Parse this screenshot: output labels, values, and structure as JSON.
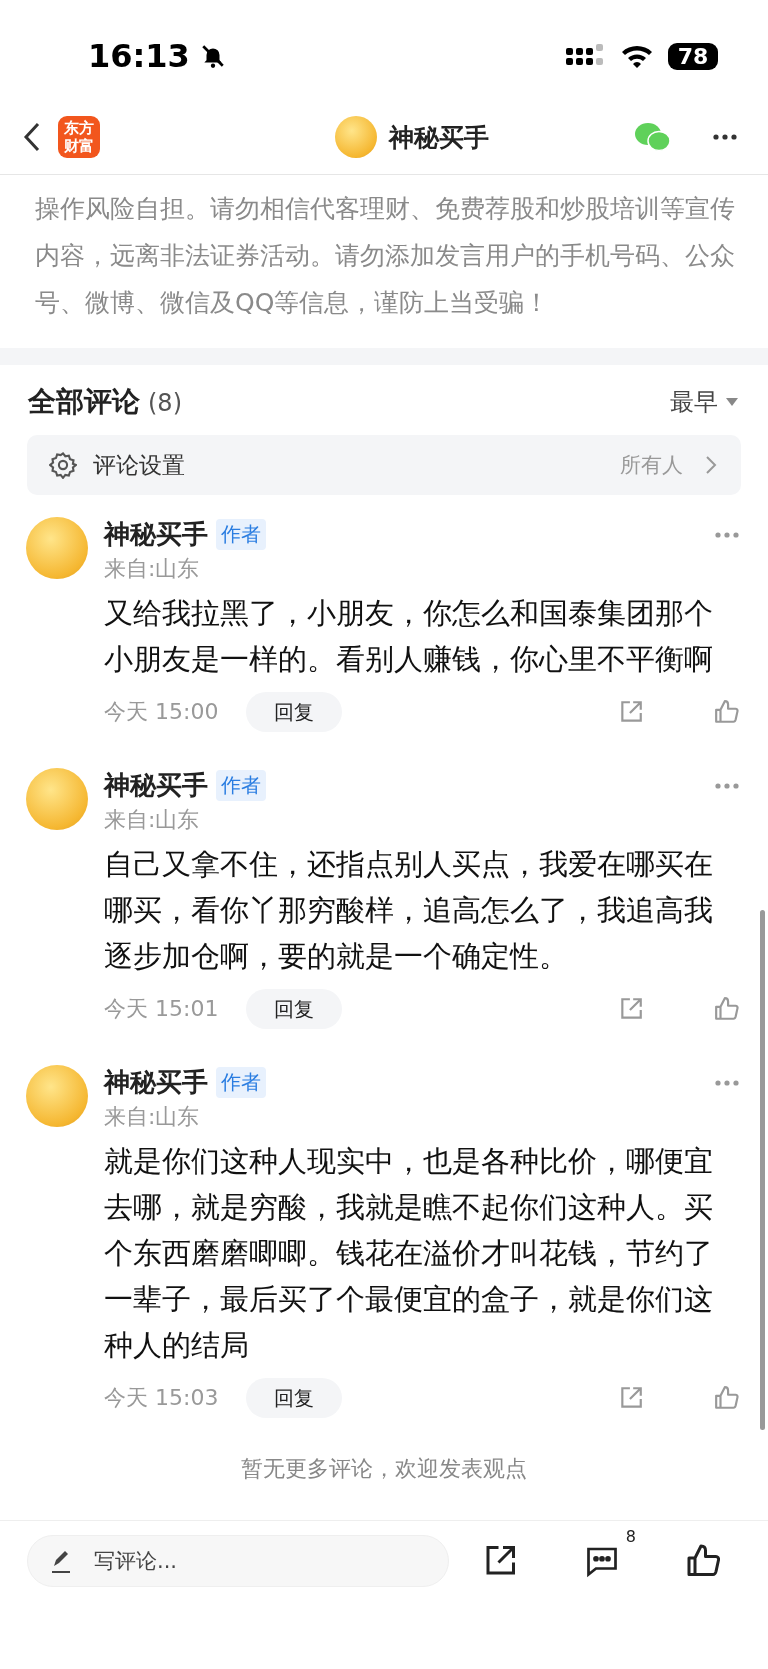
{
  "status_bar": {
    "time": "16:13",
    "battery": "78"
  },
  "header": {
    "logo_lines": [
      "东方",
      "财富"
    ],
    "title": "神秘买手"
  },
  "disclaimer": "操作风险自担。请勿相信代客理财、免费荐股和炒股培训等宣传内容，远离非法证券活动。请勿添加发言用户的手机号码、公众号、微博、微信及QQ等信息，谨防上当受骗！",
  "comments_header": {
    "title": "全部评论",
    "count": "(8)",
    "sort": "最早"
  },
  "comment_settings": {
    "label": "评论设置",
    "value": "所有人"
  },
  "comments": [
    {
      "author": "神秘买手",
      "badge": "作者",
      "location": "来自:山东",
      "text": "又给我拉黑了，小朋友，你怎么和国泰集团那个小朋友是一样的。看别人赚钱，你心里不平衡啊",
      "time": "今天 15:00",
      "reply": "回复"
    },
    {
      "author": "神秘买手",
      "badge": "作者",
      "location": "来自:山东",
      "text": "自己又拿不住，还指点别人买点，我爱在哪买在哪买，看你丫那穷酸样，追高怎么了，我追高我逐步加仓啊，要的就是一个确定性。",
      "time": "今天 15:01",
      "reply": "回复"
    },
    {
      "author": "神秘买手",
      "badge": "作者",
      "location": "来自:山东",
      "text": "就是你们这种人现实中，也是各种比价，哪便宜去哪，就是穷酸，我就是瞧不起你们这种人。买个东西磨磨唧唧。钱花在溢价才叫花钱，节约了一辈子，最后买了个最便宜的盒子，就是你们这种人的结局",
      "time": "今天 15:03",
      "reply": "回复"
    }
  ],
  "end_note": "暂无更多评论，欢迎发表观点",
  "bottom_bar": {
    "placeholder": "写评论...",
    "comment_count": "8"
  }
}
